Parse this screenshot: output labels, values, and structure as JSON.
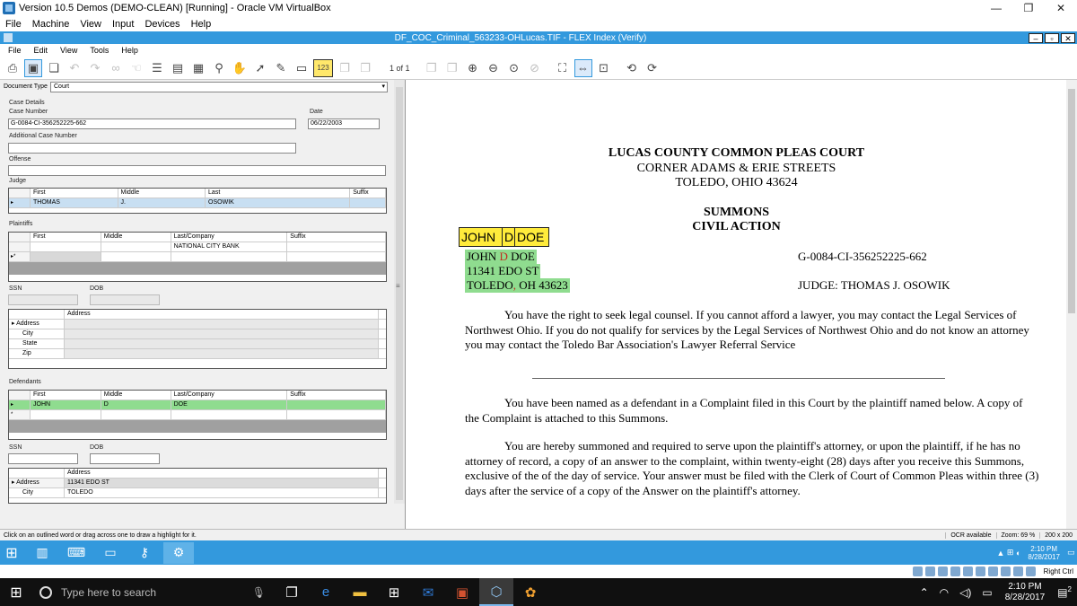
{
  "host": {
    "title": "Version 10.5 Demos (DEMO-CLEAN) [Running] - Oracle VM VirtualBox",
    "menu": [
      "File",
      "Machine",
      "View",
      "Input",
      "Devices",
      "Help"
    ]
  },
  "app": {
    "title": "DF_COC_Criminal_563233-OHLucas.TIF - FLEX Index (Verify)",
    "menu": [
      "File",
      "Edit",
      "View",
      "Tools",
      "Help"
    ],
    "page_indicator": "1 of 1",
    "box_tool_label": "123"
  },
  "form": {
    "document_type_label": "Document Type",
    "document_type_value": "Court",
    "case_details_label": "Case Details",
    "case_number_label": "Case Number",
    "case_number_value": "G-0084-CI-356252225-662",
    "date_label": "Date",
    "date_value": "06/22/2003",
    "additional_case_label": "Additional Case Number",
    "offense_label": "Offense",
    "judge_label": "Judge",
    "judge_columns": [
      "First",
      "Middle",
      "Last",
      "Suffix"
    ],
    "judge_row": [
      "THOMAS",
      "J.",
      "OSOWIK",
      ""
    ],
    "plaintiffs_label": "Plaintiffs",
    "plaintiffs_columns": [
      "First",
      "Middle",
      "Last/Company",
      "Suffix"
    ],
    "plaintiffs_row": [
      "",
      "",
      "NATIONAL CITY BANK",
      ""
    ],
    "new_row_marker": "▸*",
    "ssn_label": "SSN",
    "dob_label": "DOB",
    "address_header": "Address",
    "address_labels": [
      "Address",
      "City",
      "State",
      "Zip"
    ],
    "defendants_label": "Defendants",
    "defendants_columns": [
      "First",
      "Middle",
      "Last/Company",
      "Suffix"
    ],
    "defendants_row": [
      "JOHN",
      "D",
      "DOE",
      ""
    ],
    "defendants_new_marker": "*",
    "def_ssn_label": "SSN",
    "def_dob_label": "DOB",
    "def_address_header": "Address",
    "def_address_label": "Address",
    "def_address_value": "11341 EDO ST",
    "def_city_label": "City",
    "def_city_value": "TOLEDO"
  },
  "document": {
    "court_name": "LUCAS COUNTY COMMON PLEAS COURT",
    "street": "CORNER ADAMS & ERIE STREETS",
    "city": "TOLEDO, OHIO  43624",
    "summons": "SUMMONS",
    "civil_action": "CIVIL ACTION",
    "hl_first": "JOHN",
    "hl_middle": "D",
    "hl_last": "DOE",
    "addr_line1_a": "JOHN ",
    "addr_line1_red": "D",
    "addr_line1_b": " DOE",
    "addr_line2": "11341 EDO ST",
    "addr_line3_a": "TOLEDO",
    "addr_line3_red": ",",
    "addr_line3_b": " OH 43623",
    "case_number": "G-0084-CI-356252225-662",
    "judge": "JUDGE: THOMAS J. OSOWIK",
    "para1": "You have the right to seek legal counsel.  If you cannot afford a lawyer, you may contact the Legal Services of Northwest Ohio.  If you do not qualify for services by the Legal Services of Northwest Ohio and do not know an attorney you may contact the Toledo Bar Association's Lawyer Referral Service",
    "para2": "You have been named as a defendant in a Complaint filed in this Court by the plaintiff named below.  A copy of the Complaint  is attached to this Summons.",
    "para3": "You are hereby summoned and required to serve upon the plaintiff's attorney, or upon the plaintiff, if he has no attorney of record, a copy of an answer to the complaint, within twenty-eight (28) days after you receive this Summons, exclusive of the of the day of service.  Your answer must be filed with the Clerk of Court of Common Pleas within three (3) days after the service of a copy of the Answer on the plaintiff's attorney."
  },
  "status": {
    "message": "Click on an outlined word or drag across one to draw a highlight for it.",
    "ocr": "OCR available",
    "zoom": "Zoom: 69 %",
    "dpi": "200 x 200"
  },
  "guest_taskbar": {
    "time": "2:10 PM",
    "date": "8/28/2017"
  },
  "vbox_status": {
    "host_key": "Right Ctrl"
  },
  "host_taskbar": {
    "search_placeholder": "Type here to search",
    "time": "2:10 PM",
    "date": "8/28/2017",
    "notification_count": "2"
  }
}
